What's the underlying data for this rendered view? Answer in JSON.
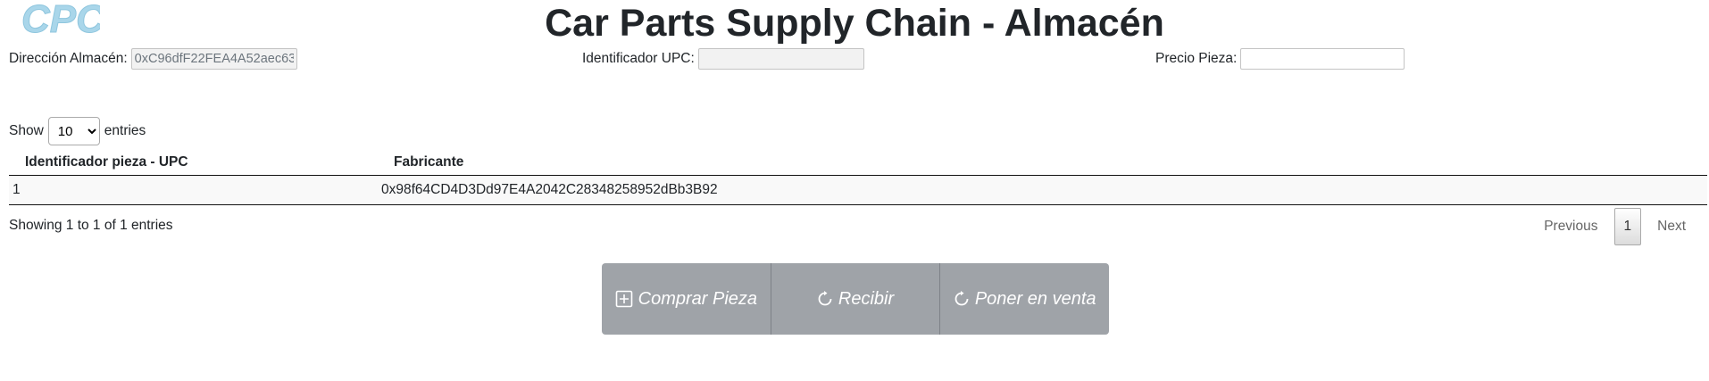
{
  "header": {
    "logo_text": "CPC",
    "title": "Car Parts Supply Chain - Almacén"
  },
  "fields": {
    "warehouse_address": {
      "label": "Dirección Almacén:",
      "value": "0xC96dfF22FEA4A52aec63"
    },
    "upc": {
      "label": "Identificador UPC:",
      "value": ""
    },
    "price": {
      "label": "Precio Pieza:",
      "value": ""
    }
  },
  "table_controls": {
    "show_label": "Show",
    "entries_label": "entries",
    "page_size": "10",
    "page_size_options": [
      "10"
    ]
  },
  "table": {
    "columns": [
      "Identificador pieza - UPC",
      "Fabricante"
    ],
    "rows": [
      {
        "upc": "1",
        "manufacturer": "0x98f64CD4D3Dd97E4A2042C28348258952dBb3B92"
      }
    ]
  },
  "footer": {
    "info": "Showing 1 to 1 of 1 entries",
    "previous": "Previous",
    "current_page": "1",
    "next": "Next"
  },
  "actions": {
    "buy": "Comprar Pieza",
    "receive": "Recibir",
    "sell": "Poner en venta"
  },
  "colors": {
    "logo": "#a9d6ea",
    "button_bg": "#9fa3a8"
  }
}
